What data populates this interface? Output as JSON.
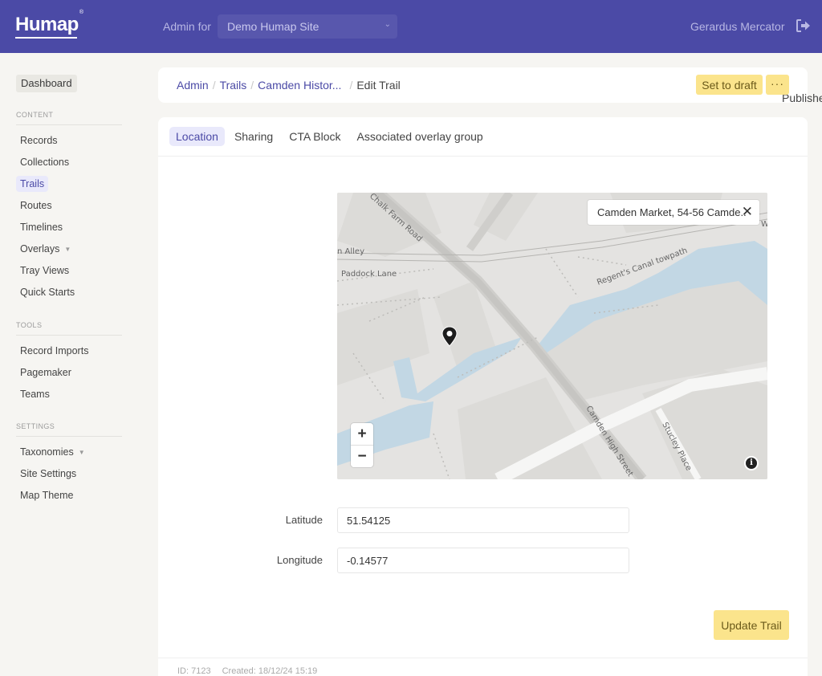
{
  "topbar": {
    "logo": "Humap",
    "admin_for_label": "Admin for",
    "site_selected": "Demo Humap Site",
    "user_name": "Gerardus Mercator",
    "icons": {
      "site_dropdown": "chevron-down-icon",
      "logout": "logout-icon"
    }
  },
  "sidebar": {
    "dashboard": "Dashboard",
    "sections": [
      {
        "title": "CONTENT",
        "items": [
          {
            "label": "Records"
          },
          {
            "label": "Collections"
          },
          {
            "label": "Trails",
            "active": true
          },
          {
            "label": "Routes"
          },
          {
            "label": "Timelines"
          },
          {
            "label": "Overlays",
            "has_dropdown": true
          },
          {
            "label": "Tray Views"
          },
          {
            "label": "Quick Starts"
          }
        ]
      },
      {
        "title": "TOOLS",
        "items": [
          {
            "label": "Record Imports"
          },
          {
            "label": "Pagemaker"
          },
          {
            "label": "Teams"
          }
        ]
      },
      {
        "title": "SETTINGS",
        "items": [
          {
            "label": "Taxonomies",
            "has_dropdown": true
          },
          {
            "label": "Site Settings"
          },
          {
            "label": "Map Theme"
          }
        ]
      }
    ]
  },
  "breadcrumb": {
    "items": [
      "Admin",
      "Trails",
      "Camden Histor..."
    ],
    "current": "Edit Trail",
    "separator": "/"
  },
  "status": {
    "label": "Published",
    "color": "#66c46a"
  },
  "actions": {
    "set_to_draft": "Set to draft",
    "more": "···"
  },
  "tabs": [
    {
      "label": "Location",
      "active": true
    },
    {
      "label": "Sharing"
    },
    {
      "label": "CTA Block"
    },
    {
      "label": "Associated overlay group"
    }
  ],
  "map": {
    "search_result": "Camden Market, 54-56 Camde..",
    "close_symbol": "✕",
    "zoom_in": "+",
    "zoom_out": "−",
    "info_symbol": "i",
    "labels": {
      "chalk_farm_road": "Chalk Farm Road",
      "alley": "n Alley",
      "paddock_lane": "Paddock Lane",
      "canal_towpath": "Regent's Canal towpath",
      "high_street": "Camden High Street",
      "stucley_place": "Stucley Place",
      "edge_wa": "Wa"
    }
  },
  "form": {
    "latitude_label": "Latitude",
    "latitude_value": "51.54125",
    "longitude_label": "Longitude",
    "longitude_value": "-0.14577",
    "submit": "Update Trail"
  },
  "footer": {
    "id": "ID: 7123",
    "created": "Created: 18/12/24 15:19"
  },
  "colors": {
    "brand": "#4b4aa6",
    "accent_yellow": "#fbe48c",
    "water": "#c2d7e4"
  }
}
